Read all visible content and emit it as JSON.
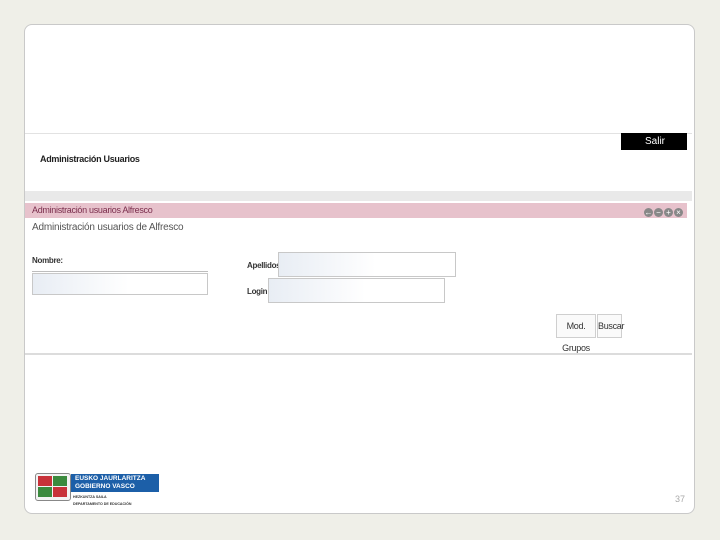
{
  "header": {
    "logout_label": "Salir",
    "page_title": "Administración Usuarios"
  },
  "portlet": {
    "title": "Administración usuarios Alfresco",
    "subtitle": "Administración usuarios de Alfresco",
    "controls": [
      "back-icon",
      "minimize-icon",
      "maximize-icon",
      "close-icon"
    ]
  },
  "form": {
    "nombre_label": "Nombre:",
    "apellidos_label": "Apellidos:",
    "login_label": "Login:",
    "nombre_value": "",
    "apellidos_value": "",
    "login_value": ""
  },
  "buttons": {
    "modify_groups_label": "Mod. Grupos",
    "search_label": "Buscar"
  },
  "logo": {
    "line1": "EUSKO JAURLARITZA",
    "line2": "GOBIERNO VASCO",
    "dept1": "HEZKUNTZA SAILA",
    "dept2": "DEPARTAMENTO DE EDUCACIÓN"
  },
  "slide": {
    "page_number": "37"
  },
  "colors": {
    "accent": "#e7c2cc",
    "brand": "#1c5fa8"
  }
}
